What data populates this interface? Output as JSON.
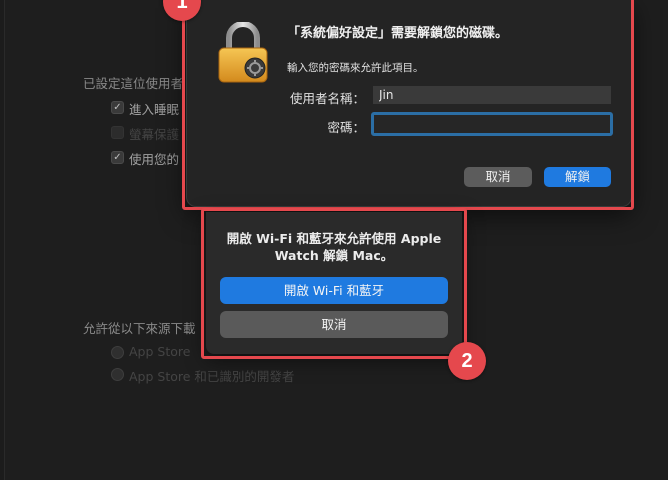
{
  "background": {
    "section1_heading": "已設定這位使用者",
    "options": [
      {
        "label": "進入睡眠",
        "checked": true
      },
      {
        "label": "螢幕保護",
        "checked": false,
        "dimmed": true
      },
      {
        "label": "使用您的",
        "checked": true
      }
    ],
    "section2_heading": "允許從以下來源下載",
    "radio_options": [
      {
        "label": "App Store"
      },
      {
        "label": "App Store 和已識別的開發者"
      }
    ]
  },
  "unlock_dialog": {
    "title": "「系統偏好設定」需要解鎖您的磁碟。",
    "subtitle": "輸入您的密碼來允許此項目。",
    "username_label": "使用者名稱：",
    "username_value": "Jin",
    "password_label": "密碼：",
    "password_value": "",
    "cancel_label": "取消",
    "unlock_label": "解鎖",
    "icon": "lock-icon"
  },
  "wifi_prompt": {
    "message": "開啟 Wi-Fi 和藍牙來允許使用 Apple Watch 解鎖 Mac。",
    "enable_label": "開啟 Wi-Fi 和藍牙",
    "cancel_label": "取消"
  },
  "annotations": {
    "badge_1": "1",
    "badge_2": "2",
    "color": "#e5484d"
  },
  "colors": {
    "accent_blue": "#1f7ae0",
    "focus_ring": "#2b6ea5"
  }
}
